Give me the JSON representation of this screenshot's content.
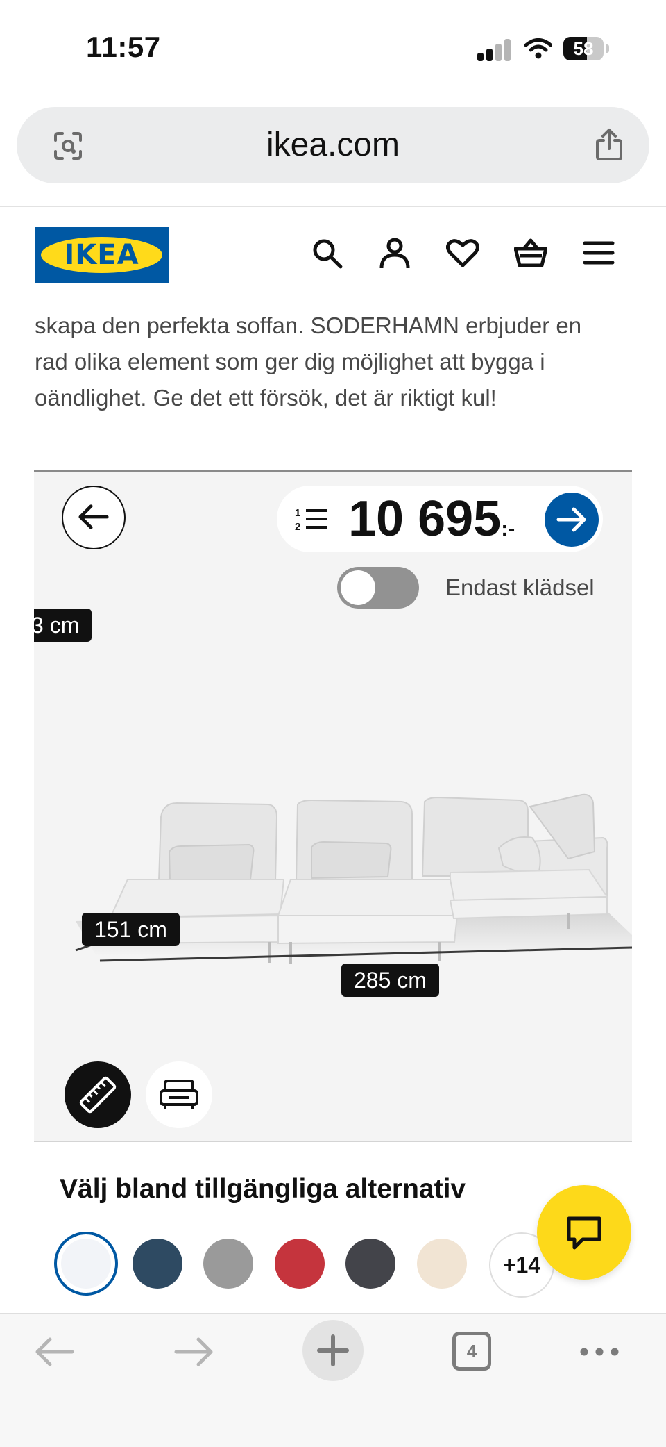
{
  "status_bar": {
    "time": "11:57",
    "battery": "58",
    "battery_level": 0.58
  },
  "browser": {
    "url": "ikea.com",
    "tab_count": "4"
  },
  "brand": {
    "logo_text": "IKEA",
    "blue": "#0058a3",
    "yellow": "#ffda1a"
  },
  "header_icons": [
    "search-icon",
    "account-icon",
    "heart-icon",
    "cart-icon",
    "menu-icon"
  ],
  "description": [
    "skapa den perfekta soffan. SODERHAMN erbjuder en",
    "rad olika element som ger dig möjlighet att bygga i",
    "oändlighet. Ge det ett försök, det är riktigt kul!"
  ],
  "viewer": {
    "price": "10 695",
    "currency": ":-",
    "toggle_label": "Endast klädsel",
    "toggle_on": false,
    "dimensions": {
      "height": "3 cm",
      "depth": "151 cm",
      "width": "285 cm"
    }
  },
  "options": {
    "title": "Välj bland tillgängliga alternativ",
    "swatches": [
      "#f2f4f8",
      "#2e4a62",
      "#9a9a9a",
      "#c5343d",
      "#43444a",
      "#f1e4d3"
    ],
    "more_label": "+14"
  }
}
